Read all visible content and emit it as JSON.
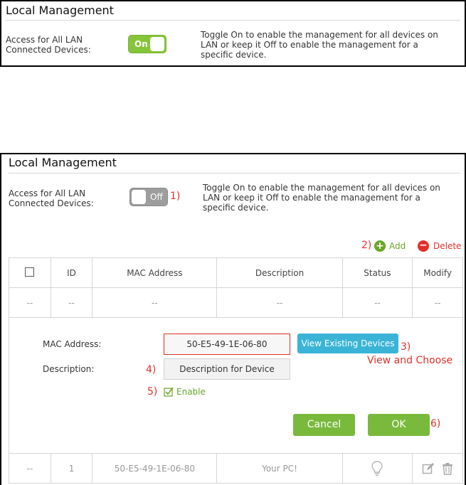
{
  "top_panel": {
    "title": "Local Management",
    "access_label_line1": "Access for All LAN",
    "access_label_line2": "Connected Devices:",
    "toggle_label": "On",
    "help_line1": "Toggle On to enable the management for all devices on",
    "help_line2": "LAN or keep it Off to enable the management for a",
    "help_line3": "specific device."
  },
  "bottom_panel": {
    "title": "Local Management",
    "access_label_line1": "Access for All LAN",
    "access_label_line2": "Connected Devices:",
    "toggle_label": "Off",
    "help_line1": "Toggle On to enable the management for all devices on",
    "help_line2": "LAN or keep it Off to enable the management for a",
    "help_line3": "specific device.",
    "annotation_1": "1)",
    "annotation_2": "2)",
    "annotation_3": "3)",
    "annotation_4": "4)",
    "annotation_5": "5)",
    "annotation_6": "6)",
    "view_and_choose": "View and Choose",
    "add_label": "Add",
    "delete_label": "Delete",
    "table": {
      "headers": [
        "ID",
        "MAC Address",
        "Description",
        "Status",
        "Modify"
      ],
      "empty_row": [
        "--",
        "--",
        "--",
        "--",
        "--",
        "--"
      ],
      "data_row": {
        "col0": "--",
        "id": "1",
        "mac": "50-E5-49-1E-06-80",
        "description": "Your PC!"
      }
    },
    "form": {
      "mac_label": "MAC Address:",
      "mac_value": "50-E5-49-1E-06-80",
      "view_devices_label": "View Existing Devices",
      "description_label": "Description:",
      "description_value": "Description for Device",
      "enable_label": "Enable",
      "cancel_label": "Cancel",
      "ok_label": "OK"
    }
  },
  "colors": {
    "accent_green": "#79b93c",
    "accent_blue": "#3ab4d6",
    "annotation_red": "#e0302a",
    "delete_red": "#e0302a"
  }
}
